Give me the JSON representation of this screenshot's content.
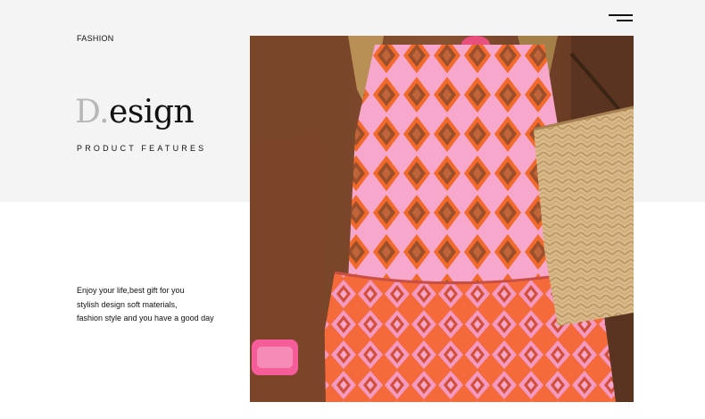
{
  "header": {
    "brand_tag": "FASHION",
    "menu_icon": "hamburger-menu-icon"
  },
  "hero": {
    "title_initial": "D.",
    "title_rest": "esign",
    "subtitle": "PRODUCT FEATURES"
  },
  "description": {
    "lines": [
      "Enjoy your life,best gift for you",
      "stylish design soft materials,",
      "fashion style and you have a good day"
    ]
  },
  "colors": {
    "band": "#f4f4f4",
    "accent_grey": "#b7b7b7",
    "dress_pink": "#f7a0c8",
    "dress_orange": "#f2692a",
    "dress_brown": "#9b4f2b",
    "bag_straw": "#d9b98a"
  }
}
